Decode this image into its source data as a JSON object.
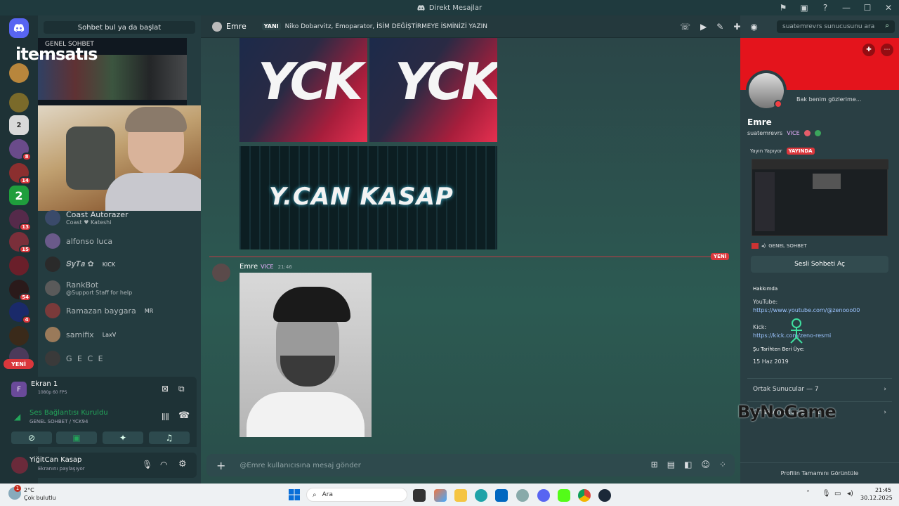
{
  "window": {
    "title": "Direkt Mesajlar"
  },
  "brand": {
    "logo_text": "itemsatıs",
    "watermark": "ByNoGame"
  },
  "sidebar": {
    "search_label": "Sohbet bul ya da başlat",
    "overlay_text": "GENEL SOHBET",
    "server_badges": [
      "8",
      "14",
      "13",
      "15",
      "54",
      "4"
    ],
    "new_label": "YENİ",
    "members": [
      {
        "name": "Coast Autorazer",
        "sub": "Coast ♥ Kateshi",
        "tag": ""
      },
      {
        "name": "alfonso luca",
        "sub": "",
        "tag": ""
      },
      {
        "name": "𝑺𝒚𝑻𝒂 ✿",
        "sub": "",
        "tag": "KICK"
      },
      {
        "name": "RankBot",
        "sub": "@Support Staff for help",
        "tag": ""
      },
      {
        "name": "Ramazan baygara",
        "sub": "",
        "tag": "MR"
      },
      {
        "name": "samifix",
        "sub": "",
        "tag": "LaxV"
      },
      {
        "name": "G E C E",
        "sub": "",
        "tag": ""
      }
    ]
  },
  "stream_panel": {
    "title": "Ekran 1",
    "quality": "1080p 60 FPS"
  },
  "voice_panel": {
    "status": "Ses Bağlantısı Kuruldu",
    "channel": "GENEL SOHBET / YCK94"
  },
  "user_panel": {
    "name": "YiğitCan Kasap",
    "status": "Ekranını paylaşıyor"
  },
  "chat_header": {
    "name": "Emre",
    "new_tag": "YANI",
    "topic": "Niko Dobarvitz, Emoparator, İSİM DEĞİŞTİRMEYE İSMİNİZİ YAZIN",
    "search_placeholder": "suatemrevrs sunucusunu ara"
  },
  "messages": {
    "banner_text": "YCK",
    "banner2_text": "Y.CAN KASAP",
    "new_divider": "YENİ",
    "author": "Emre",
    "author_tag": "VICE",
    "time": "21:46"
  },
  "input": {
    "placeholder": "@Emre kullanıcısına mesaj gönder"
  },
  "profile": {
    "status_note": "Bak benim gözlerime...",
    "display_name": "Emre",
    "username": "suatemrevrs",
    "tag": "VICE",
    "live_heading": "Yayın Yapıyor",
    "live_badge": "YAYINDA",
    "channel": "GENEL SOHBET",
    "join_button": "Sesli Sohbeti Aç",
    "about_heading": "Hakkımda",
    "youtube_label": "YouTube:",
    "youtube_url": "https://www.youtube.com/@zenooo00",
    "kick_label": "Kick:",
    "kick_url": "https://kick.com/zeno-resmi",
    "since_label": "Şu Tarihten Beri Üye:",
    "since_date": "15 Haz 2019",
    "mutual_servers": "Ortak Sunucular — 7",
    "mutual_friends": "Ortak Arkadaşlar — 1",
    "full_profile": "Profilin Tamamını Görüntüle"
  },
  "taskbar": {
    "weather_temp": "2°C",
    "weather_desc": "Çok bulutlu",
    "weather_badge": "1",
    "search": "Ara",
    "time": "21:45",
    "date": "30.12.2025"
  },
  "colors": {
    "accent_red": "#e4141c",
    "discord_blurple": "#5865f2",
    "live_red": "#da373c"
  }
}
